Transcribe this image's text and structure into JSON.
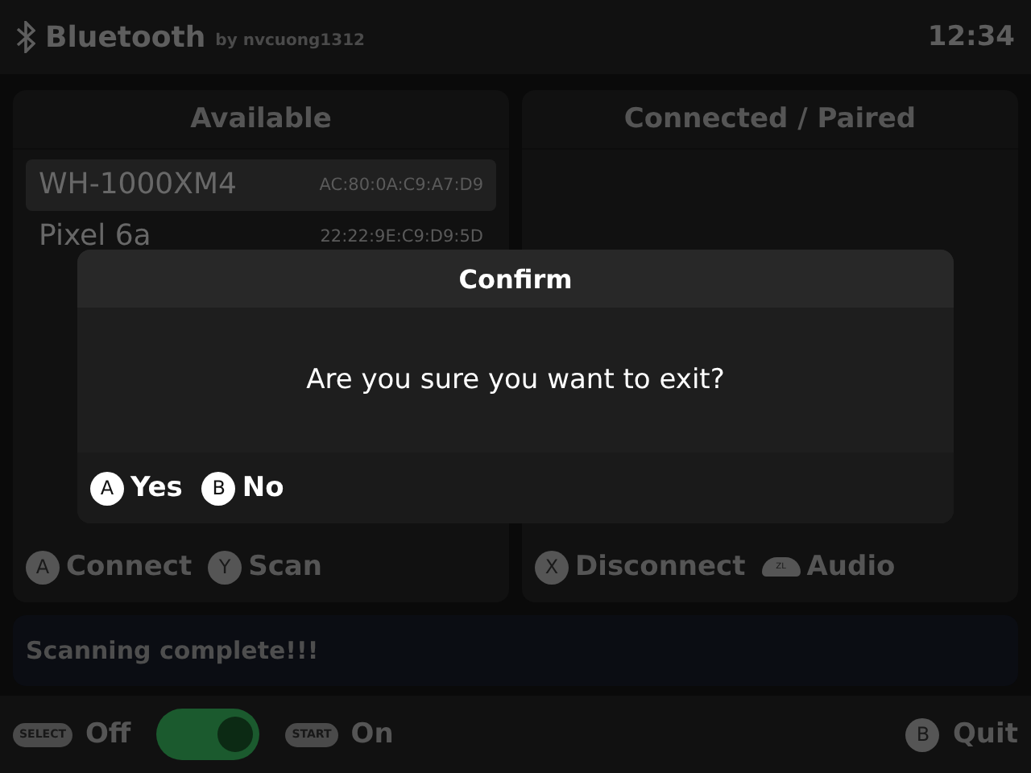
{
  "header": {
    "title": "Bluetooth",
    "author": "by nvcuong1312",
    "time": "12:34"
  },
  "panels": [
    {
      "title": "Available",
      "devices": [
        {
          "name": "WH-1000XM4",
          "address": "AC:80:0A:C9:A7:D9",
          "selected": true
        },
        {
          "name": "Pixel 6a",
          "address": "22:22:9E:C9:D9:5D",
          "selected": false
        }
      ],
      "actions": [
        {
          "key": "A",
          "kind": "round",
          "label": "Connect"
        },
        {
          "key": "Y",
          "kind": "round",
          "label": "Scan"
        }
      ]
    },
    {
      "title": "Connected / Paired",
      "actions": [
        {
          "key": "X",
          "kind": "round",
          "label": "Disconnect"
        },
        {
          "key": "ZL",
          "kind": "shoulder",
          "label": "Audio"
        }
      ]
    }
  ],
  "status": "Scanning complete!!!",
  "footer": {
    "off": {
      "key": "SELECT",
      "label": "Off"
    },
    "toggle": {
      "on": true
    },
    "on": {
      "key": "START",
      "label": "On"
    },
    "quit": {
      "key": "B",
      "label": "Quit"
    }
  },
  "dialog": {
    "title": "Confirm",
    "message": "Are you sure you want to exit?",
    "buttons": [
      {
        "key": "A",
        "label": "Yes"
      },
      {
        "key": "B",
        "label": "No"
      }
    ]
  }
}
